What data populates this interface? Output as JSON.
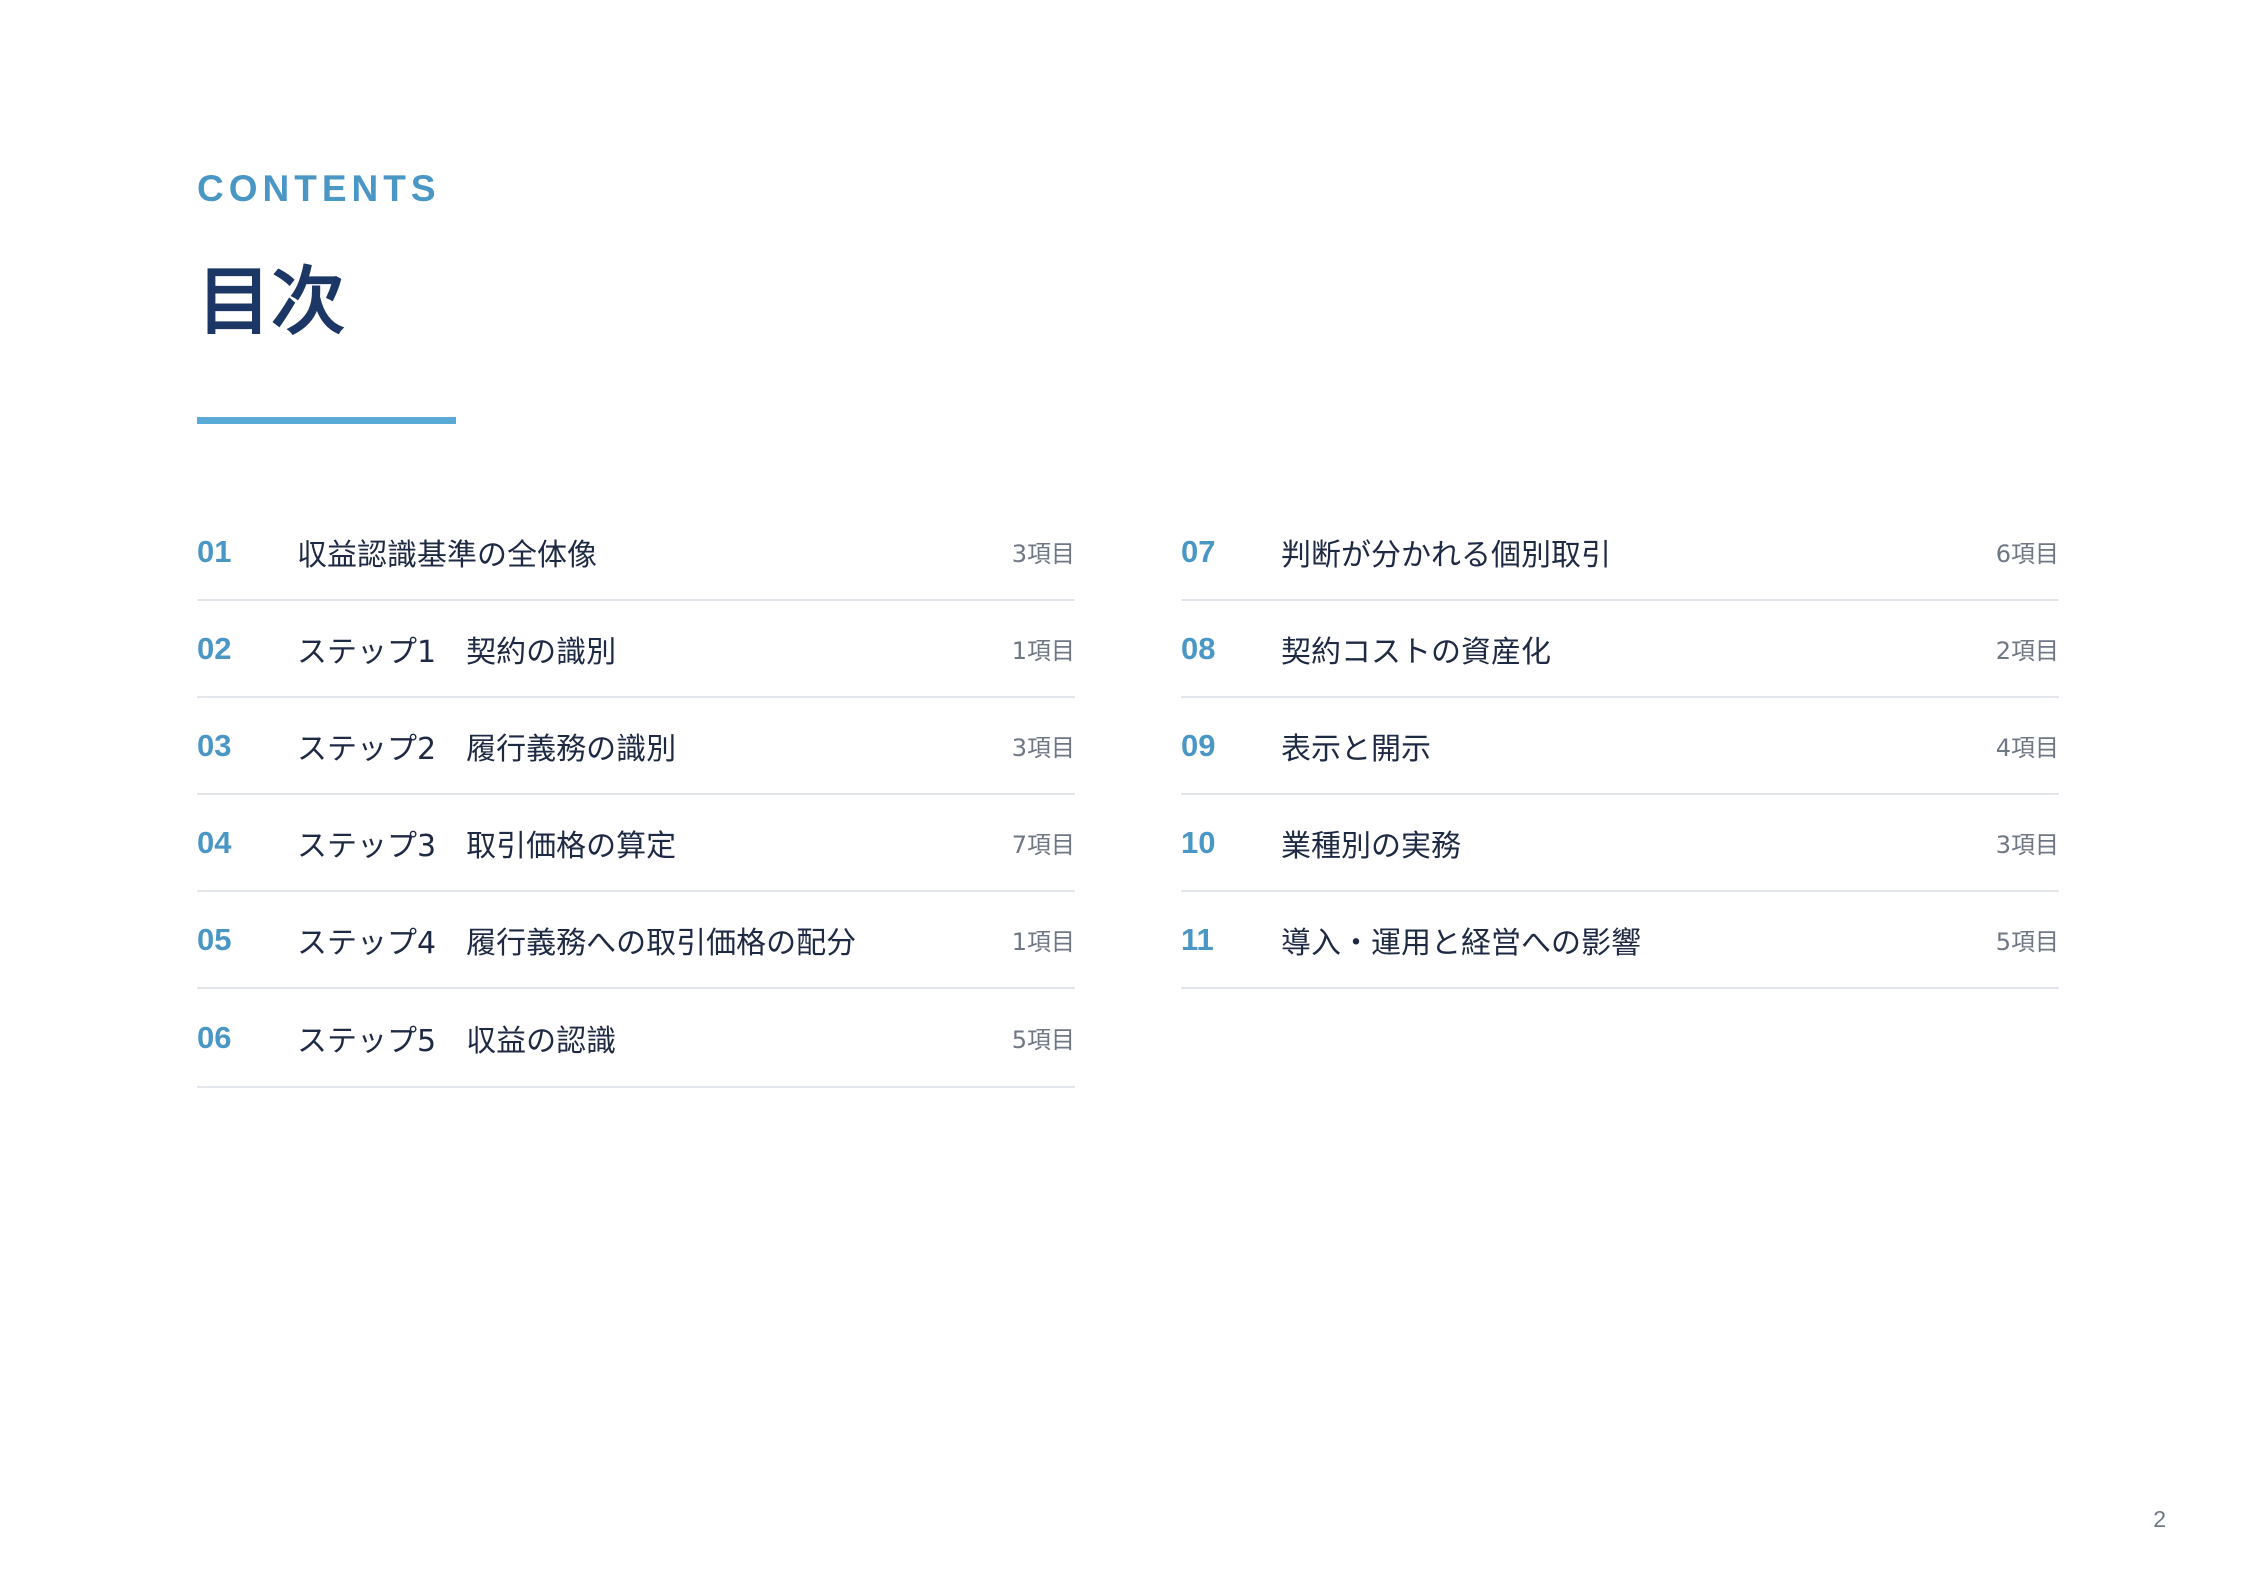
{
  "header": {
    "eyebrow": "CONTENTS",
    "title": "目次"
  },
  "toc": {
    "left": [
      {
        "num": "01",
        "label": "収益認識基準の全体像",
        "count": "3項目"
      },
      {
        "num": "02",
        "label": "ステップ1　契約の識別",
        "count": "1項目"
      },
      {
        "num": "03",
        "label": "ステップ2　履行義務の識別",
        "count": "3項目"
      },
      {
        "num": "04",
        "label": "ステップ3　取引価格の算定",
        "count": "7項目"
      },
      {
        "num": "05",
        "label": "ステップ4　履行義務への取引価格の配分",
        "count": "1項目"
      },
      {
        "num": "06",
        "label": "ステップ5　収益の認識",
        "count": "5項目"
      }
    ],
    "right": [
      {
        "num": "07",
        "label": "判断が分かれる個別取引",
        "count": "6項目"
      },
      {
        "num": "08",
        "label": "契約コストの資産化",
        "count": "2項目"
      },
      {
        "num": "09",
        "label": "表示と開示",
        "count": "4項目"
      },
      {
        "num": "10",
        "label": "業種別の実務",
        "count": "3項目"
      },
      {
        "num": "11",
        "label": "導入・運用と経営への影響",
        "count": "5項目"
      }
    ]
  },
  "footer": {
    "page_number": "2"
  },
  "colors": {
    "accent": "#4a97c6",
    "title": "#1c3766",
    "bar": "#5aaad8"
  }
}
